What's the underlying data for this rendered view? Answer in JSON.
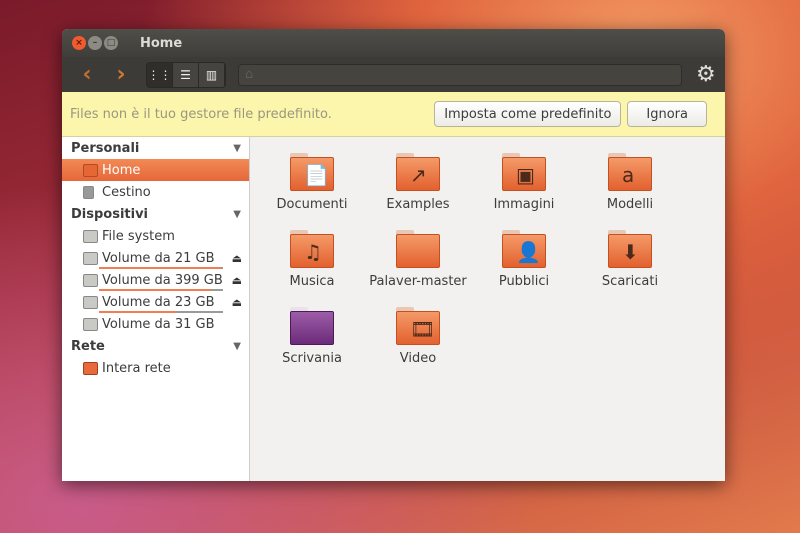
{
  "window": {
    "title": "Home"
  },
  "toolbar": {
    "back_icon": "‹",
    "forward_icon": "›",
    "views": [
      "grid-view",
      "list-view",
      "column-view"
    ],
    "path_home_icon": "⌂"
  },
  "infobar": {
    "message": "Files non è il tuo gestore file predefinito.",
    "set_default": "Imposta come predefinito",
    "ignore": "Ignora"
  },
  "sidebar": {
    "sections": [
      {
        "title": "Personali",
        "items": [
          {
            "label": "Home",
            "selected": true
          },
          {
            "label": "Cestino"
          }
        ]
      },
      {
        "title": "Dispositivi",
        "items": [
          {
            "label": "File system"
          },
          {
            "label": "Volume da 21 GB",
            "usage": 0.98,
            "eject": true
          },
          {
            "label": "Volume da 399 GB",
            "usage": 0.9,
            "eject": true
          },
          {
            "label": "Volume da 23 GB",
            "usage": 0.62,
            "eject": true
          },
          {
            "label": "Volume da 31 GB"
          }
        ]
      },
      {
        "title": "Rete",
        "items": [
          {
            "label": "Intera rete"
          }
        ]
      }
    ]
  },
  "files": [
    {
      "name": "Documenti",
      "emblem": "📄"
    },
    {
      "name": "Examples",
      "emblem": "↗"
    },
    {
      "name": "Immagini",
      "emblem": "▣"
    },
    {
      "name": "Modelli",
      "emblem": "a"
    },
    {
      "name": "Musica",
      "emblem": "♫"
    },
    {
      "name": "Palaver-master",
      "emblem": ""
    },
    {
      "name": "Pubblici",
      "emblem": "👤"
    },
    {
      "name": "Scaricati",
      "emblem": "⬇"
    },
    {
      "name": "Scrivania",
      "emblem": "",
      "desktop": true
    },
    {
      "name": "Video",
      "emblem": "🎞"
    }
  ]
}
